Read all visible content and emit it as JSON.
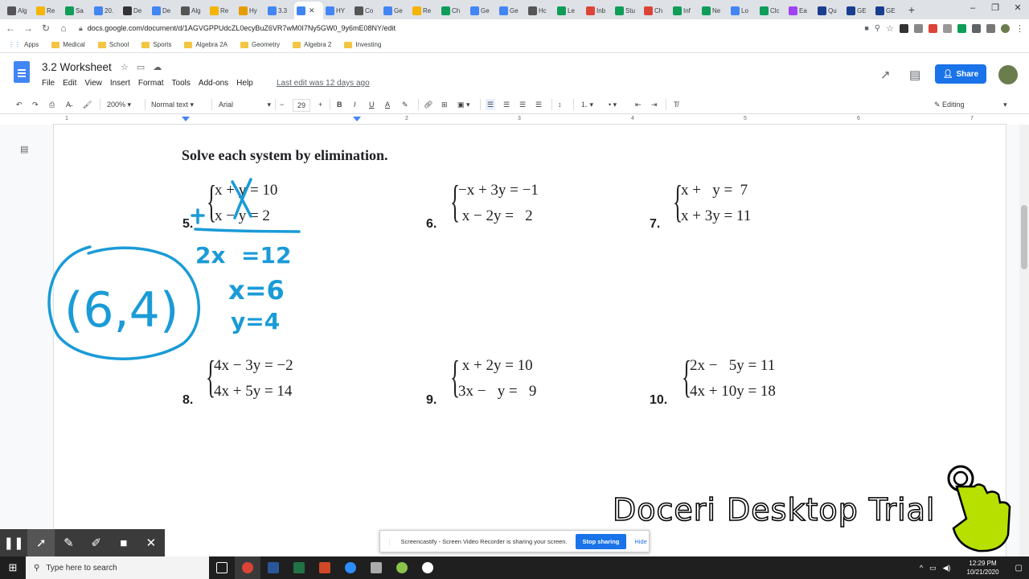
{
  "browser": {
    "tabs": [
      {
        "label": "Alg",
        "color": "#555"
      },
      {
        "label": "Re",
        "color": "#f4b400"
      },
      {
        "label": "Sa",
        "color": "#0f9d58"
      },
      {
        "label": "20.",
        "color": "#4285f4"
      },
      {
        "label": "De",
        "color": "#333"
      },
      {
        "label": "De",
        "color": "#4285f4"
      },
      {
        "label": "Alg",
        "color": "#555"
      },
      {
        "label": "Re",
        "color": "#f4b400"
      },
      {
        "label": "Hy",
        "color": "#e69c00"
      },
      {
        "label": "3.3",
        "color": "#4285f4"
      },
      {
        "label": "",
        "color": "#4285f4",
        "active": true
      },
      {
        "label": "HY",
        "color": "#4285f4"
      },
      {
        "label": "Co",
        "color": "#555"
      },
      {
        "label": "Ge",
        "color": "#4285f4"
      },
      {
        "label": "Re",
        "color": "#f4b400"
      },
      {
        "label": "Ch",
        "color": "#0f9d58"
      },
      {
        "label": "Ge",
        "color": "#4285f4"
      },
      {
        "label": "Ge",
        "color": "#4285f4"
      },
      {
        "label": "Hc",
        "color": "#555"
      },
      {
        "label": "Le",
        "color": "#0f9d58"
      },
      {
        "label": "Inb",
        "color": "#db4437"
      },
      {
        "label": "Stu",
        "color": "#0f9d58"
      },
      {
        "label": "Ch",
        "color": "#db4437"
      },
      {
        "label": "Inf",
        "color": "#0f9d58"
      },
      {
        "label": "Ne",
        "color": "#0f9d58"
      },
      {
        "label": "Lo",
        "color": "#4285f4"
      },
      {
        "label": "Clc",
        "color": "#0f9d58"
      },
      {
        "label": "Ea",
        "color": "#a142f4"
      },
      {
        "label": "Qu",
        "color": "#1a3e8f"
      },
      {
        "label": "GE",
        "color": "#1a3e8f"
      },
      {
        "label": "GE",
        "color": "#1a3e8f"
      }
    ],
    "url": "docs.google.com/document/d/1AGVGPPUdcZL0ecyBuZ6VR7wM0I7Ny5GW0_9y6mE08NY/edit",
    "bookmarks": [
      "Apps",
      "Medical",
      "School",
      "Sports",
      "Algebra 2A",
      "Geometry",
      "Algebra 2",
      "Investing"
    ]
  },
  "doc": {
    "title": "3.2 Worksheet",
    "menus": [
      "File",
      "Edit",
      "View",
      "Insert",
      "Format",
      "Tools",
      "Add-ons",
      "Help"
    ],
    "last_edit": "Last edit was 12 days ago",
    "share": "Share",
    "toolbar": {
      "zoom": "200%",
      "style": "Normal text",
      "font": "Arial",
      "size": "29",
      "mode": "Editing"
    },
    "ruler_numbers": [
      "1",
      "1",
      "2",
      "3",
      "4",
      "5",
      "6",
      "7"
    ]
  },
  "worksheet": {
    "heading": "Solve each system by elimination.",
    "problems": [
      {
        "num": "5.",
        "eq1": "x + y = 10",
        "eq2": "x − y = 2"
      },
      {
        "num": "6.",
        "eq1": "−x + 3y = −1",
        "eq2": " x − 2y =   2"
      },
      {
        "num": "7.",
        "eq1": "x +   y =  7",
        "eq2": "x + 3y = 11"
      },
      {
        "num": "8.",
        "eq1": "4x − 3y = −2",
        "eq2": "4x + 5y = 14"
      },
      {
        "num": "9.",
        "eq1": " x + 2y = 10",
        "eq2": "3x −   y =   9"
      },
      {
        "num": "10.",
        "eq1": "2x −   5y = 11",
        "eq2": "4x + 10y = 18"
      }
    ],
    "ink": {
      "plus": "+",
      "sum": "2x  =12",
      "x_val": "x=6",
      "y_val": "y=4",
      "answer": "(6,4)",
      "color": "#1a9bd7"
    }
  },
  "overlay": {
    "watermark": "Doceri Desktop Trial",
    "screencastify_msg": "Screencastify - Screen Video Recorder is sharing your screen.",
    "stop_sharing": "Stop sharing",
    "hide": "Hide"
  },
  "taskbar": {
    "search_placeholder": "Type here to search",
    "time": "12:29 PM",
    "date": "10/21/2020"
  }
}
